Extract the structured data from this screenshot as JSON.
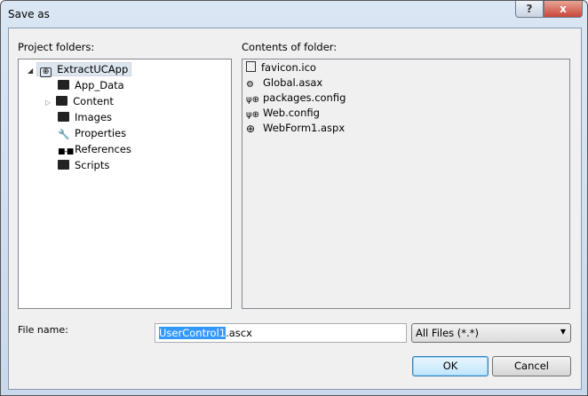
{
  "window": {
    "title": "Save as",
    "help_label": "?",
    "close_label": "x"
  },
  "left": {
    "label": "Project folders:",
    "root": "ExtractUCApp",
    "items": [
      {
        "label": "App_Data",
        "icon": "folder-icon"
      },
      {
        "label": "Content",
        "icon": "folder-icon",
        "expandable": true
      },
      {
        "label": "Images",
        "icon": "folder-icon"
      },
      {
        "label": "Properties",
        "icon": "wrench-icon"
      },
      {
        "label": "References",
        "icon": "references-icon"
      },
      {
        "label": "Scripts",
        "icon": "folder-icon"
      }
    ]
  },
  "right": {
    "label": "Contents of folder:",
    "files": [
      {
        "label": "favicon.ico",
        "icon": "image-file-icon"
      },
      {
        "label": "Global.asax",
        "icon": "gear-file-icon"
      },
      {
        "label": "packages.config",
        "icon": "config-file-icon"
      },
      {
        "label": "Web.config",
        "icon": "config-file-icon"
      },
      {
        "label": "WebForm1.aspx",
        "icon": "globe-icon"
      }
    ]
  },
  "file_name": {
    "label": "File name:",
    "selected_part": "UserControl1",
    "rest": ".ascx"
  },
  "filter": {
    "value": "All Files (*.*)"
  },
  "buttons": {
    "ok": "OK",
    "cancel": "Cancel"
  }
}
